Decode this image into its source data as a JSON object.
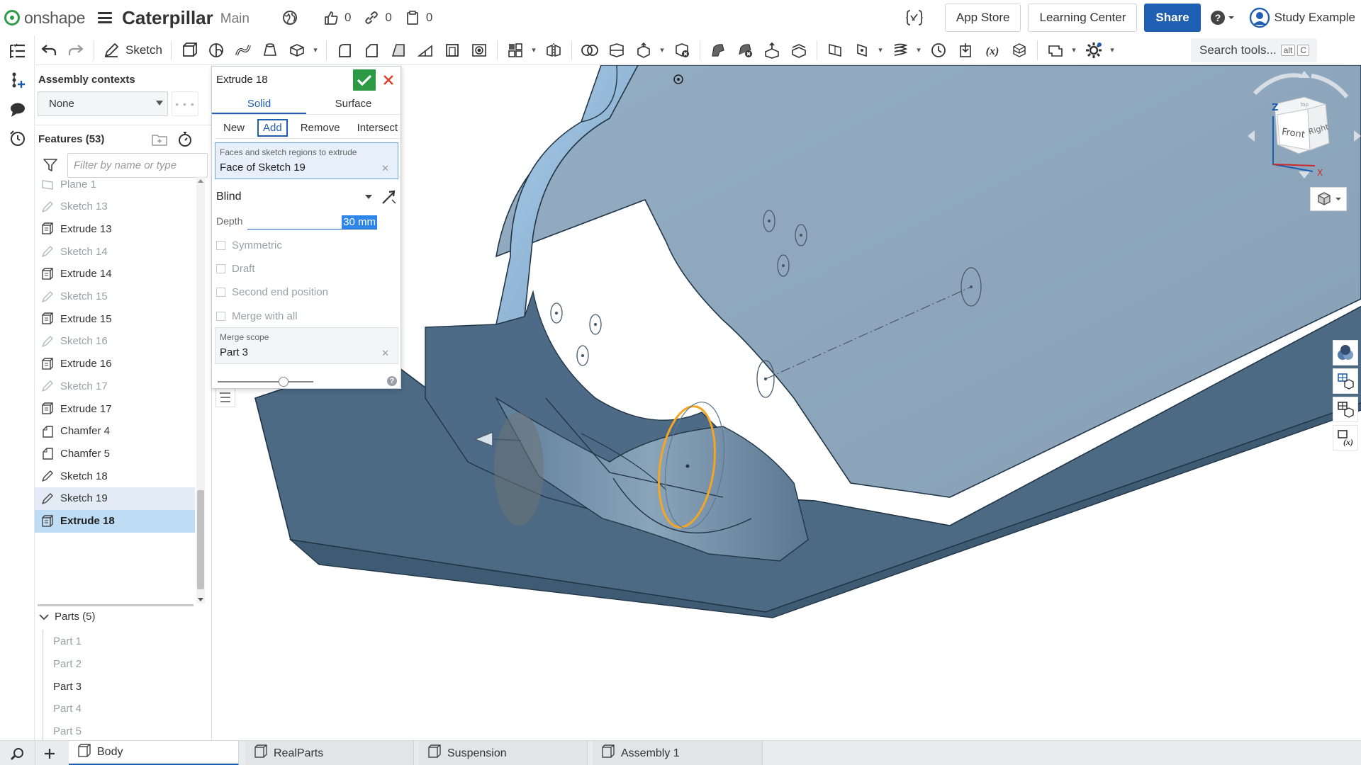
{
  "header": {
    "logo_text": "onshape",
    "doc_title": "Caterpillar",
    "branch": "Main",
    "likes": "0",
    "links": "0",
    "copies": "0",
    "buttons": {
      "app_store": "App Store",
      "learning_center": "Learning Center",
      "share": "Share"
    },
    "user_name": "Study Example"
  },
  "toolbar": {
    "sketch_label": "Sketch",
    "search_label": "Search tools...",
    "search_kbd_1": "alt",
    "search_kbd_2": "C"
  },
  "feature_panel": {
    "assembly_contexts_label": "Assembly contexts",
    "context_value": "None",
    "features_label": "Features (53)",
    "filter_placeholder": "Filter by name or type",
    "features": [
      {
        "label": "Plane 1",
        "type": "plane",
        "state": "dim"
      },
      {
        "label": "Sketch 13",
        "type": "sketch",
        "state": "dim"
      },
      {
        "label": "Extrude 13",
        "type": "extrude",
        "state": "normal"
      },
      {
        "label": "Sketch 14",
        "type": "sketch",
        "state": "dim"
      },
      {
        "label": "Extrude 14",
        "type": "extrude",
        "state": "normal"
      },
      {
        "label": "Sketch 15",
        "type": "sketch",
        "state": "dim"
      },
      {
        "label": "Extrude 15",
        "type": "extrude",
        "state": "normal"
      },
      {
        "label": "Sketch 16",
        "type": "sketch",
        "state": "dim"
      },
      {
        "label": "Extrude 16",
        "type": "extrude",
        "state": "normal"
      },
      {
        "label": "Sketch 17",
        "type": "sketch",
        "state": "dim"
      },
      {
        "label": "Extrude 17",
        "type": "extrude",
        "state": "normal"
      },
      {
        "label": "Chamfer 4",
        "type": "chamfer",
        "state": "normal"
      },
      {
        "label": "Chamfer 5",
        "type": "chamfer",
        "state": "normal"
      },
      {
        "label": "Sketch 18",
        "type": "sketch",
        "state": "normal"
      },
      {
        "label": "Sketch 19",
        "type": "sketch",
        "state": "hover"
      },
      {
        "label": "Extrude 18",
        "type": "extrude",
        "state": "selected"
      }
    ],
    "parts_label": "Parts (5)",
    "parts": [
      {
        "label": "Part 1",
        "state": "dim"
      },
      {
        "label": "Part 2",
        "state": "dim"
      },
      {
        "label": "Part 3",
        "state": "normal"
      },
      {
        "label": "Part 4",
        "state": "dim"
      },
      {
        "label": "Part 5",
        "state": "dim"
      }
    ]
  },
  "dialog": {
    "title": "Extrude 18",
    "tabs": [
      "Solid",
      "Surface"
    ],
    "active_tab": "Solid",
    "operations": [
      "New",
      "Add",
      "Remove",
      "Intersect"
    ],
    "active_operation": "Add",
    "faces_caption": "Faces and sketch regions to extrude",
    "faces_value": "Face of Sketch 19",
    "end_type": "Blind",
    "depth_label": "Depth",
    "depth_value": "30 mm",
    "options": [
      "Symmetric",
      "Draft",
      "Second end position",
      "Merge with all"
    ],
    "merge_scope_caption": "Merge scope",
    "merge_scope_value": "Part 3",
    "help_glyph": "?"
  },
  "view_cube": {
    "front": "Front",
    "right": "Right",
    "top": "Top",
    "axis_z": "Z",
    "axis_x": "X"
  },
  "bottom_tabs": [
    {
      "label": "Body",
      "active": true
    },
    {
      "label": "RealParts",
      "active": false
    },
    {
      "label": "Suspension",
      "active": false
    },
    {
      "label": "Assembly 1",
      "active": false
    }
  ],
  "colors": {
    "accent": "#1f5fb2",
    "ok": "#2c9a44",
    "cancel": "#d9442e",
    "model_light": "#90aac0",
    "model_dark": "#4f6e89",
    "selection": "#f4a623"
  }
}
